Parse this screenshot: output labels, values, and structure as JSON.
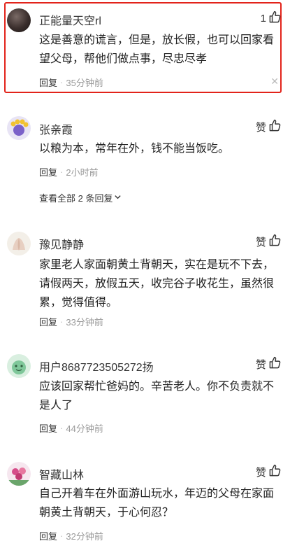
{
  "comments": [
    {
      "username": "正能量天空rl",
      "like_count": "1",
      "text_lines": [
        "这是善意的谎言，但是，放长假，也可以回家看",
        "望父母，帮他们做点事，尽忠尽孝"
      ],
      "reply_label": "回复",
      "time": "35分钟前",
      "highlighted": true
    },
    {
      "username": "张亲霞",
      "like_label": "赞",
      "text_lines": [
        "以粮为本，常年在外，钱不能当饭吃。"
      ],
      "reply_label": "回复",
      "time": "2小时前",
      "view_all": "查看全部 2 条回复"
    },
    {
      "username": "豫见静静",
      "like_label": "赞",
      "text_lines": [
        "家里老人家面朝黄土背朝天，实在是玩不下去，",
        "请假两天，放假五天，收完谷子收花生，虽然很",
        "累，觉得值得。"
      ],
      "reply_label": "回复",
      "time": "33分钟前"
    },
    {
      "username": "用户8687723505272扬",
      "like_label": "赞",
      "text_lines": [
        "应该回家帮忙爸妈的。辛苦老人。你不负责就不",
        "是人了"
      ],
      "reply_label": "回复",
      "time": "44分钟前"
    },
    {
      "username": "智藏山林",
      "like_label": "赞",
      "text_lines": [
        "自己开着车在外面游山玩水，年迈的父母在家面",
        "朝黄土背朝天，于心何忍？"
      ],
      "reply_label": "回复",
      "time": "32分钟前"
    }
  ],
  "icons": {
    "like": "thumbs-up-icon",
    "dismiss": "close-icon",
    "expand": "chevron-down-icon"
  },
  "colors": {
    "highlight_border": "#e2231a",
    "meta_text": "#999999"
  }
}
